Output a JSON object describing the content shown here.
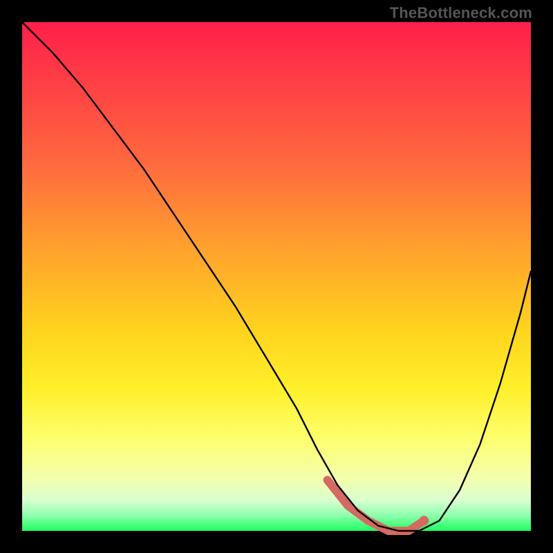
{
  "watermark": "TheBottleneck.com",
  "colors": {
    "frame": "#000000",
    "curve": "#000000",
    "highlight": "#d46a62",
    "gradient_top": "#ff1f4b",
    "gradient_bottom": "#1eff5e"
  },
  "chart_data": {
    "type": "line",
    "title": "",
    "xlabel": "",
    "ylabel": "",
    "xlim": [
      0,
      100
    ],
    "ylim": [
      0,
      100
    ],
    "grid": false,
    "legend": false,
    "series": [
      {
        "name": "bottleneck-curve",
        "x": [
          0,
          6,
          12,
          18,
          24,
          30,
          36,
          42,
          48,
          54,
          58,
          62,
          66,
          70,
          74,
          78,
          82,
          86,
          90,
          94,
          98,
          100
        ],
        "y": [
          100,
          94,
          87,
          79,
          71,
          62,
          53,
          44,
          34,
          24,
          16,
          9,
          4,
          1,
          0,
          0,
          2,
          8,
          17,
          29,
          43,
          51
        ]
      }
    ],
    "highlight": {
      "name": "optimal-range",
      "x": [
        60,
        64,
        68,
        72,
        76,
        79
      ],
      "y": [
        10,
        5,
        2,
        0,
        0,
        2
      ]
    },
    "highlight_end_dot": {
      "x": 79,
      "y": 2
    }
  }
}
